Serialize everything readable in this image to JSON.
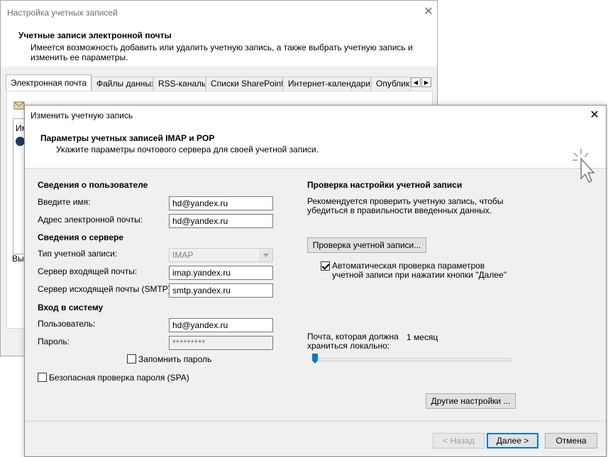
{
  "back_window": {
    "title": "Настройка учетных записей",
    "header_title": "Учетные записи электронной почты",
    "header_desc": "Имеется возможность добавить или удалить учетную запись, а также выбрать учетную запись и изменить ее параметры.",
    "tabs": [
      {
        "label": "Электронная почта"
      },
      {
        "label": "Файлы данных"
      },
      {
        "label": "RSS-каналы"
      },
      {
        "label": "Списки SharePoint"
      },
      {
        "label": "Интернет-календари"
      },
      {
        "label": "Опубликованные календари"
      }
    ],
    "list_item": "Им",
    "hint": "Выб"
  },
  "dialog": {
    "title": "Изменить учетную запись",
    "header_title": "Параметры учетных записей IMAP и POP",
    "header_desc": "Укажите параметры почтового сервера для своей учетной записи.",
    "user_info": {
      "title": "Сведения о пользователе",
      "name_label": "Введите имя:",
      "name_value": "hd@yandex.ru",
      "email_label": "Адрес электронной почты:",
      "email_value": "hd@yandex.ru"
    },
    "server_info": {
      "title": "Сведения о сервере",
      "account_type_label": "Тип учетной записи:",
      "account_type_value": "IMAP",
      "incoming_label": "Сервер входящей почты:",
      "incoming_value": "imap.yandex.ru",
      "outgoing_label": "Сервер исходящей почты (SMTP):",
      "outgoing_value": "smtp.yandex.ru"
    },
    "logon": {
      "title": "Вход в систему",
      "user_label": "Пользователь:",
      "user_value": "hd@yandex.ru",
      "password_label": "Пароль:",
      "password_value": "*********",
      "remember_label": "Запомнить пароль",
      "remember_checked": false,
      "spa_label": "Безопасная проверка пароля (SPA)",
      "spa_checked": false
    },
    "test": {
      "title": "Проверка настройки учетной записи",
      "desc": "Рекомендуется проверить учетную запись, чтобы убедиться в правильности введенных данных.",
      "test_button": "Проверка учетной записи...",
      "auto_test_label": "Автоматическая проверка параметров учетной записи при нажатии кнопки \"Далее\"",
      "auto_test_checked": true
    },
    "offline": {
      "label": "Почта, которая должна храниться локально:",
      "value": "1 месяц",
      "slider_level": 0
    },
    "more_settings_button": "Другие настройки ...",
    "back_button": "< Назад",
    "next_button": "Далее >",
    "cancel_button": "Отмена"
  },
  "colors": {
    "accent": "#0078d7",
    "window_bg": "#f0f0f0"
  }
}
